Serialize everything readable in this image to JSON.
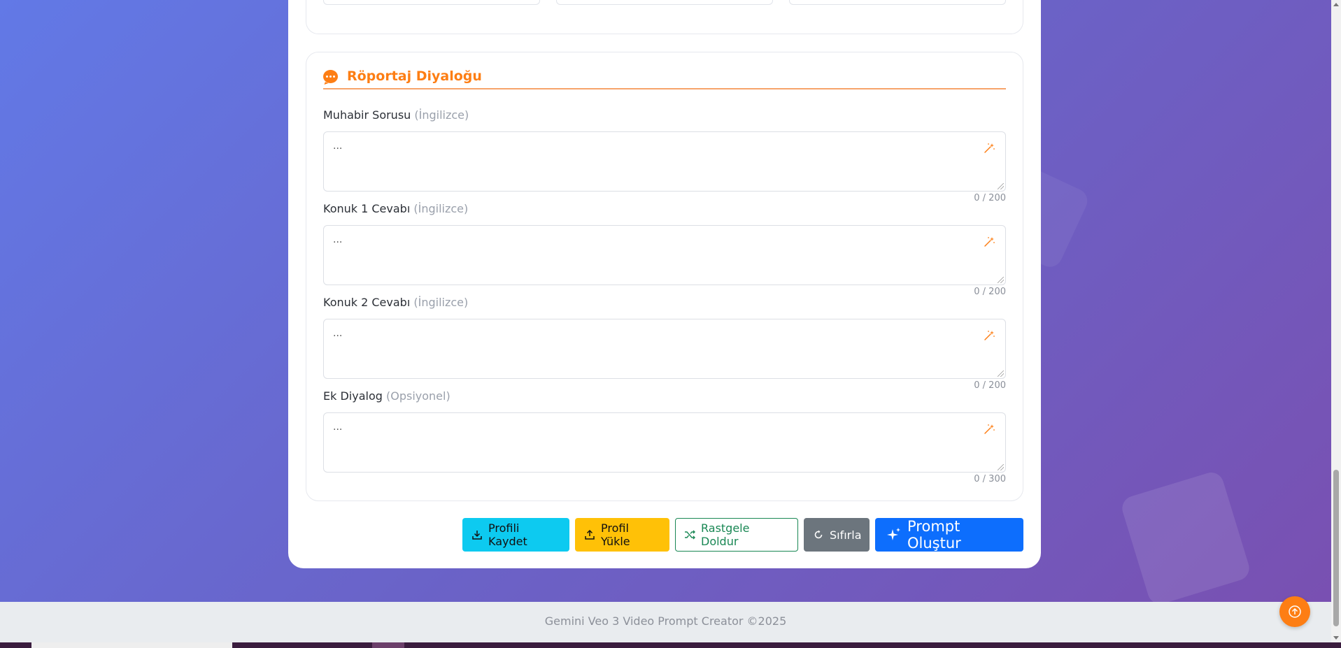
{
  "dialog_section": {
    "title": "Röportaj Diyaloğu",
    "icon": "comment-dots-icon",
    "accent_color": "#fd7e14"
  },
  "fields": [
    {
      "label": "Muhabir Sorusu",
      "hint": "(İngilizce)",
      "value": "...",
      "counter": "0 / 200"
    },
    {
      "label": "Konuk 1 Cevabı",
      "hint": "(İngilizce)",
      "value": "...",
      "counter": "0 / 200"
    },
    {
      "label": "Konuk 2 Cevabı",
      "hint": "(İngilizce)",
      "value": "...",
      "counter": "0 / 200"
    },
    {
      "label": "Ek Diyalog",
      "hint": "(Opsiyonel)",
      "value": "...",
      "counter": "0 / 300"
    }
  ],
  "actions": {
    "save_profile": "Profili Kaydet",
    "load_profile": "Profil Yükle",
    "random_fill": "Rastgele Doldur",
    "reset": "Sıfırla",
    "create_prompt": "Prompt Oluştur"
  },
  "colors": {
    "save": "#0dcaf0",
    "load": "#ffc107",
    "random": "#198754",
    "reset": "#6c757d",
    "prompt": "#0d6efd"
  },
  "footer": {
    "text": "Gemini Veo 3 Video Prompt Creator ©2025"
  }
}
